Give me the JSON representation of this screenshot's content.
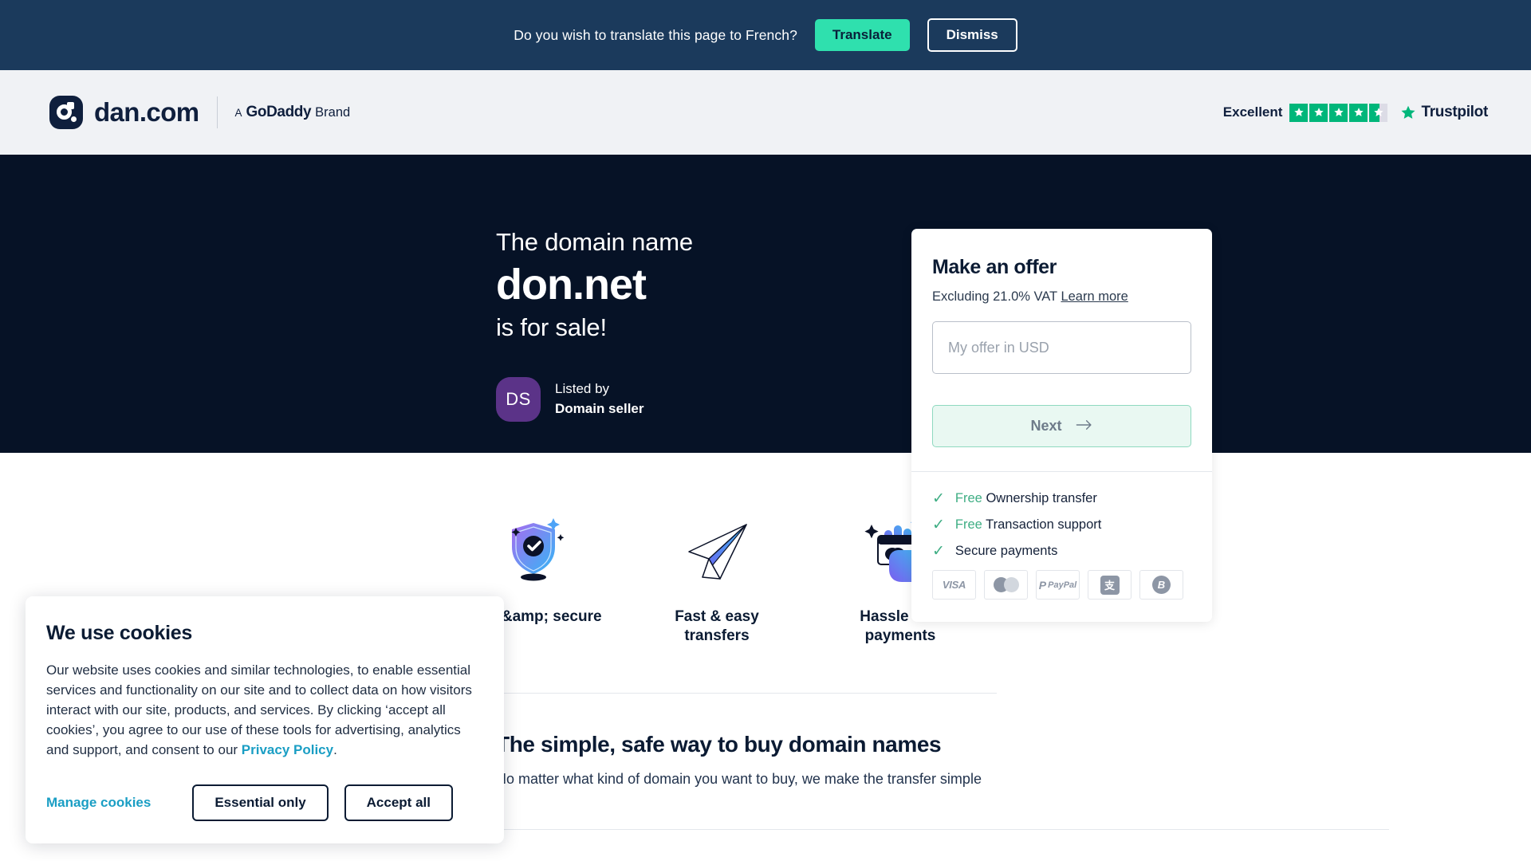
{
  "translate_bar": {
    "question": "Do you wish to translate this page to French?",
    "translate_label": "Translate",
    "dismiss_label": "Dismiss",
    "bg_color": "#1b3a5c",
    "accent_color": "#2fe0ae"
  },
  "header": {
    "logo_word": "dan.com",
    "godaddy_a": "A",
    "godaddy_name": "GoDaddy",
    "godaddy_brand": "Brand",
    "trustpilot": {
      "rating_label": "Excellent",
      "name": "Trustpilot",
      "stars_total": 5,
      "stars_filled": 4,
      "half_star_fraction": 0.55,
      "star_color": "#00b67a"
    }
  },
  "hero": {
    "line1": "The domain name",
    "domain": "don.net",
    "line3": "is for sale!",
    "seller_initials": "DS",
    "listed_by_label": "Listed by",
    "seller_name": "Domain seller",
    "bg_color": "#061226",
    "avatar_color": "#5b3388"
  },
  "offer_card": {
    "title": "Make an offer",
    "vat_text": "Excluding 21.0% VAT",
    "learn_more": "Learn more",
    "offer_placeholder": "My offer in USD",
    "offer_value": "",
    "next_label": "Next",
    "benefits": [
      {
        "free": "Free",
        "text": "Ownership transfer"
      },
      {
        "free": "Free",
        "text": "Transaction support"
      },
      {
        "free": "",
        "text": "Secure payments"
      }
    ],
    "payment_methods": [
      "visa",
      "mastercard",
      "paypal",
      "alipay",
      "bitcoin"
    ]
  },
  "features": [
    {
      "icon": "shield-check-icon",
      "label": "Safe &amp; secure"
    },
    {
      "icon": "paper-plane-icon",
      "label": "Fast & easy\ntransfers"
    },
    {
      "icon": "card-hand-icon",
      "label": "Hassle free\npayments"
    }
  ],
  "buy_section": {
    "heading": "The simple, safe way to buy domain names",
    "subheading": "No matter what kind of domain you want to buy, we make the transfer simple"
  },
  "cookie_banner": {
    "title": "We use cookies",
    "body_part1": "Our website uses cookies and similar technologies, to enable essential services and functionality on our site and to collect data on how visitors interact with our site, products, and services. By clicking ‘accept all cookies’, you agree to our use of these tools for advertising, analytics and support, and consent to our ",
    "privacy_link": "Privacy Policy",
    "body_part2": ".",
    "manage_label": "Manage cookies",
    "essential_label": "Essential only",
    "accept_label": "Accept all",
    "link_color": "#1a9ec4"
  }
}
